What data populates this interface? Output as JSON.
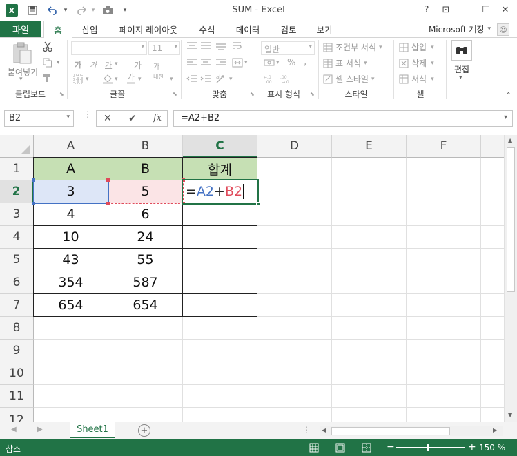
{
  "window": {
    "title": "SUM - Excel",
    "controls": {
      "help": "?",
      "restore_ribbon": "⊡",
      "minimize": "—",
      "maximize": "☐",
      "close": "✕"
    }
  },
  "quick_access": {
    "save_icon": "save-icon",
    "undo_icon": "undo-icon",
    "redo_icon": "redo-icon"
  },
  "tabs": {
    "file": "파일",
    "items": [
      "홈",
      "삽입",
      "페이지 레이아웃",
      "수식",
      "데이터",
      "검토",
      "보기"
    ],
    "active": "홈",
    "account": "Microsoft 계정"
  },
  "ribbon": {
    "clipboard": {
      "label": "클립보드",
      "paste": "붙여넣기"
    },
    "font": {
      "label": "글꼴",
      "size": "11",
      "bold": "가",
      "italic": "가",
      "underline": "가",
      "grow": "가",
      "shrink": "가",
      "phonetic": "내천"
    },
    "alignment": {
      "label": "맞춤"
    },
    "number": {
      "label": "표시 형식",
      "format": "일반",
      "percent": "%"
    },
    "styles": {
      "label": "스타일",
      "conditional": "조건부 서식",
      "table": "표 서식",
      "cell_styles": "셀 스타일"
    },
    "cells": {
      "label": "셀",
      "insert": "삽입",
      "delete": "삭제",
      "format": "서식"
    },
    "editing": {
      "label": "편집"
    }
  },
  "formula_bar": {
    "name_box": "B2",
    "cancel": "✕",
    "enter": "✔",
    "fx": "fx",
    "formula": "=A2+B2"
  },
  "columns": [
    "A",
    "B",
    "C",
    "D",
    "E",
    "F"
  ],
  "rows": [
    "1",
    "2",
    "3",
    "4",
    "5",
    "6",
    "7",
    "8",
    "9",
    "10",
    "11",
    "12"
  ],
  "cells": {
    "r1": [
      "A",
      "B",
      "합계"
    ],
    "r2": [
      "3",
      "5"
    ],
    "r3": [
      "4",
      "6"
    ],
    "r4": [
      "10",
      "24"
    ],
    "r5": [
      "43",
      "55"
    ],
    "r6": [
      "354",
      "587"
    ],
    "r7": [
      "654",
      "654"
    ]
  },
  "edit_cell": {
    "eq": "=",
    "ref1": "A2",
    "plus": "+",
    "ref2": "B2"
  },
  "colors": {
    "accent": "#217346",
    "header_fill": "#c6e0b4",
    "ref1": "#4472c4",
    "ref2": "#e04b5b"
  },
  "sheets": [
    "Sheet1"
  ],
  "status": {
    "mode": "참조",
    "zoom": "150 %"
  }
}
